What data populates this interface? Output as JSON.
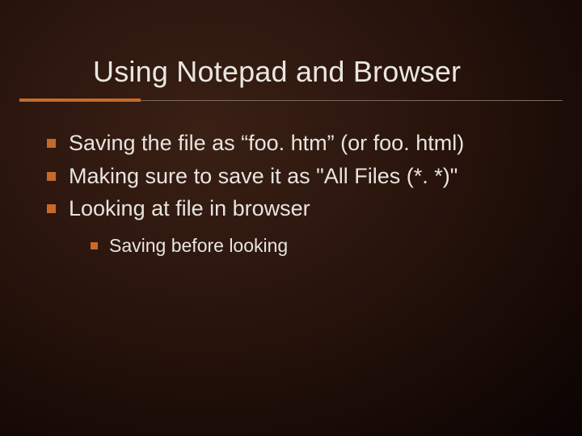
{
  "title": "Using Notepad and Browser",
  "bullets": {
    "b1": "Saving the file as “foo. htm” (or foo. html)",
    "b2": "Making sure to save it as \"All Files (*. *)\"",
    "b3": "Looking at file in browser",
    "sub1": "Saving before looking"
  }
}
